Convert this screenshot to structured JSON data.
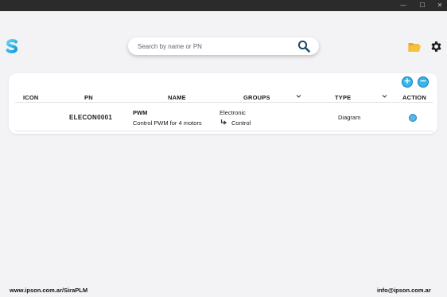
{
  "window": {
    "minimize_glyph": "—",
    "maximize_glyph": "☐",
    "close_glyph": "✕"
  },
  "brand": {
    "logo_icon": "s-logo-icon",
    "accent": "#37b6ec",
    "accent_dark": "#167fb3"
  },
  "search": {
    "placeholder": "Search by name or PN",
    "value": ""
  },
  "toolbar": {
    "add_glyph": "+",
    "remove_glyph": "−"
  },
  "table": {
    "headers": {
      "icon": "ICON",
      "pn": "PN",
      "name": "NAME",
      "groups": "GROUPS",
      "type": "TYPE",
      "action": "ACTION"
    },
    "rows": [
      {
        "pn": "ELECON0001",
        "name": "PWM",
        "description": "Control PWM for 4 motors",
        "group_main": "Electronic",
        "group_sub": "Control",
        "type": "Diagram"
      }
    ]
  },
  "footer": {
    "website": "www.ipson.com.ar/SiraPLM",
    "email": "info@ipson.com.ar"
  }
}
